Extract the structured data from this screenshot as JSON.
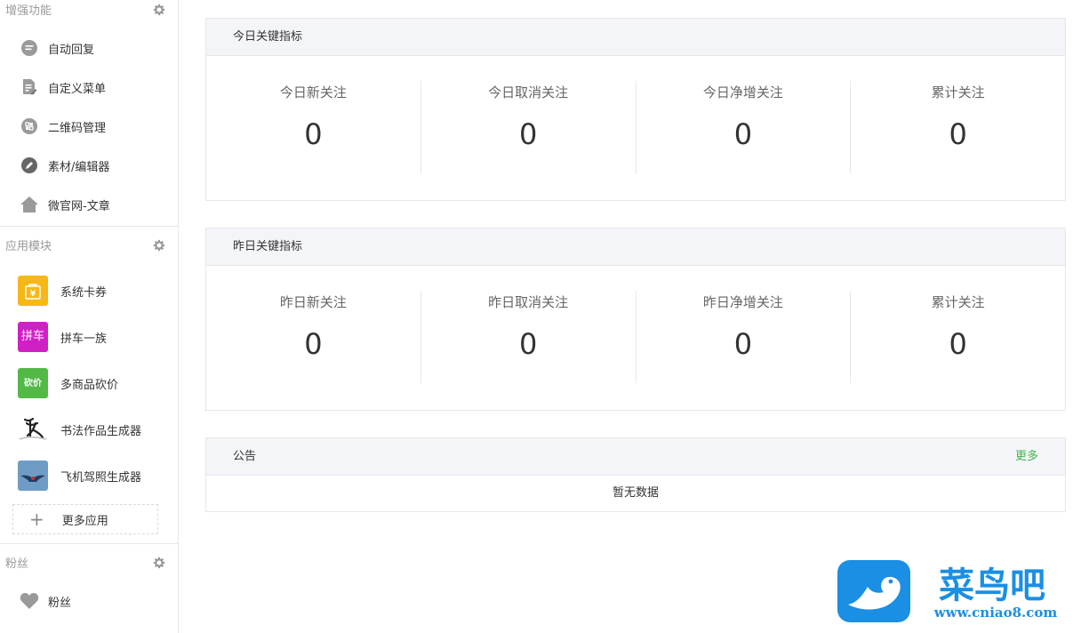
{
  "sidebar": {
    "enhanced": {
      "title": "增强功能",
      "items": [
        {
          "label": "自动回复",
          "icon": "chat-bubble-icon"
        },
        {
          "label": "自定义菜单",
          "icon": "document-edit-icon"
        },
        {
          "label": "二维码管理",
          "icon": "qrcode-icon"
        },
        {
          "label": "素材/编辑器",
          "icon": "pencil-icon"
        },
        {
          "label": "微官网-文章",
          "icon": "home-icon"
        }
      ]
    },
    "apps": {
      "title": "应用模块",
      "items": [
        {
          "label": "系统卡券",
          "icon": "coupon-icon",
          "color": "#f6b817"
        },
        {
          "label": "拼车一族",
          "icon": "carpool-icon",
          "icon_text": "拼车",
          "color": "#d11fc6"
        },
        {
          "label": "多商品砍价",
          "icon": "bargain-icon",
          "icon_text": "砍价",
          "color": "#52b947"
        },
        {
          "label": "书法作品生成器",
          "icon": "calligraphy-icon",
          "color": "#ffffff"
        },
        {
          "label": "飞机驾照生成器",
          "icon": "plane-license-icon",
          "color": "#5f8fb8"
        }
      ],
      "more_label": "更多应用"
    },
    "fans": {
      "title": "粉丝",
      "items": [
        {
          "label": "粉丝",
          "icon": "heart-icon"
        }
      ]
    }
  },
  "panels": {
    "today": {
      "title": "今日关键指标",
      "stats": [
        {
          "label": "今日新关注",
          "value": "0"
        },
        {
          "label": "今日取消关注",
          "value": "0"
        },
        {
          "label": "今日净增关注",
          "value": "0"
        },
        {
          "label": "累计关注",
          "value": "0"
        }
      ]
    },
    "yesterday": {
      "title": "昨日关键指标",
      "stats": [
        {
          "label": "昨日新关注",
          "value": "0"
        },
        {
          "label": "昨日取消关注",
          "value": "0"
        },
        {
          "label": "昨日净增关注",
          "value": "0"
        },
        {
          "label": "累计关注",
          "value": "0"
        }
      ]
    },
    "notice": {
      "title": "公告",
      "more_label": "更多",
      "empty_text": "暂无数据"
    }
  },
  "watermark": {
    "brand": "菜鸟吧",
    "url": "www.cniao8.com"
  },
  "colors": {
    "accent": "#44b549",
    "border": "#e7e7eb",
    "panel_head": "#f4f5f9",
    "watermark_blue": "#1a8fe3"
  }
}
